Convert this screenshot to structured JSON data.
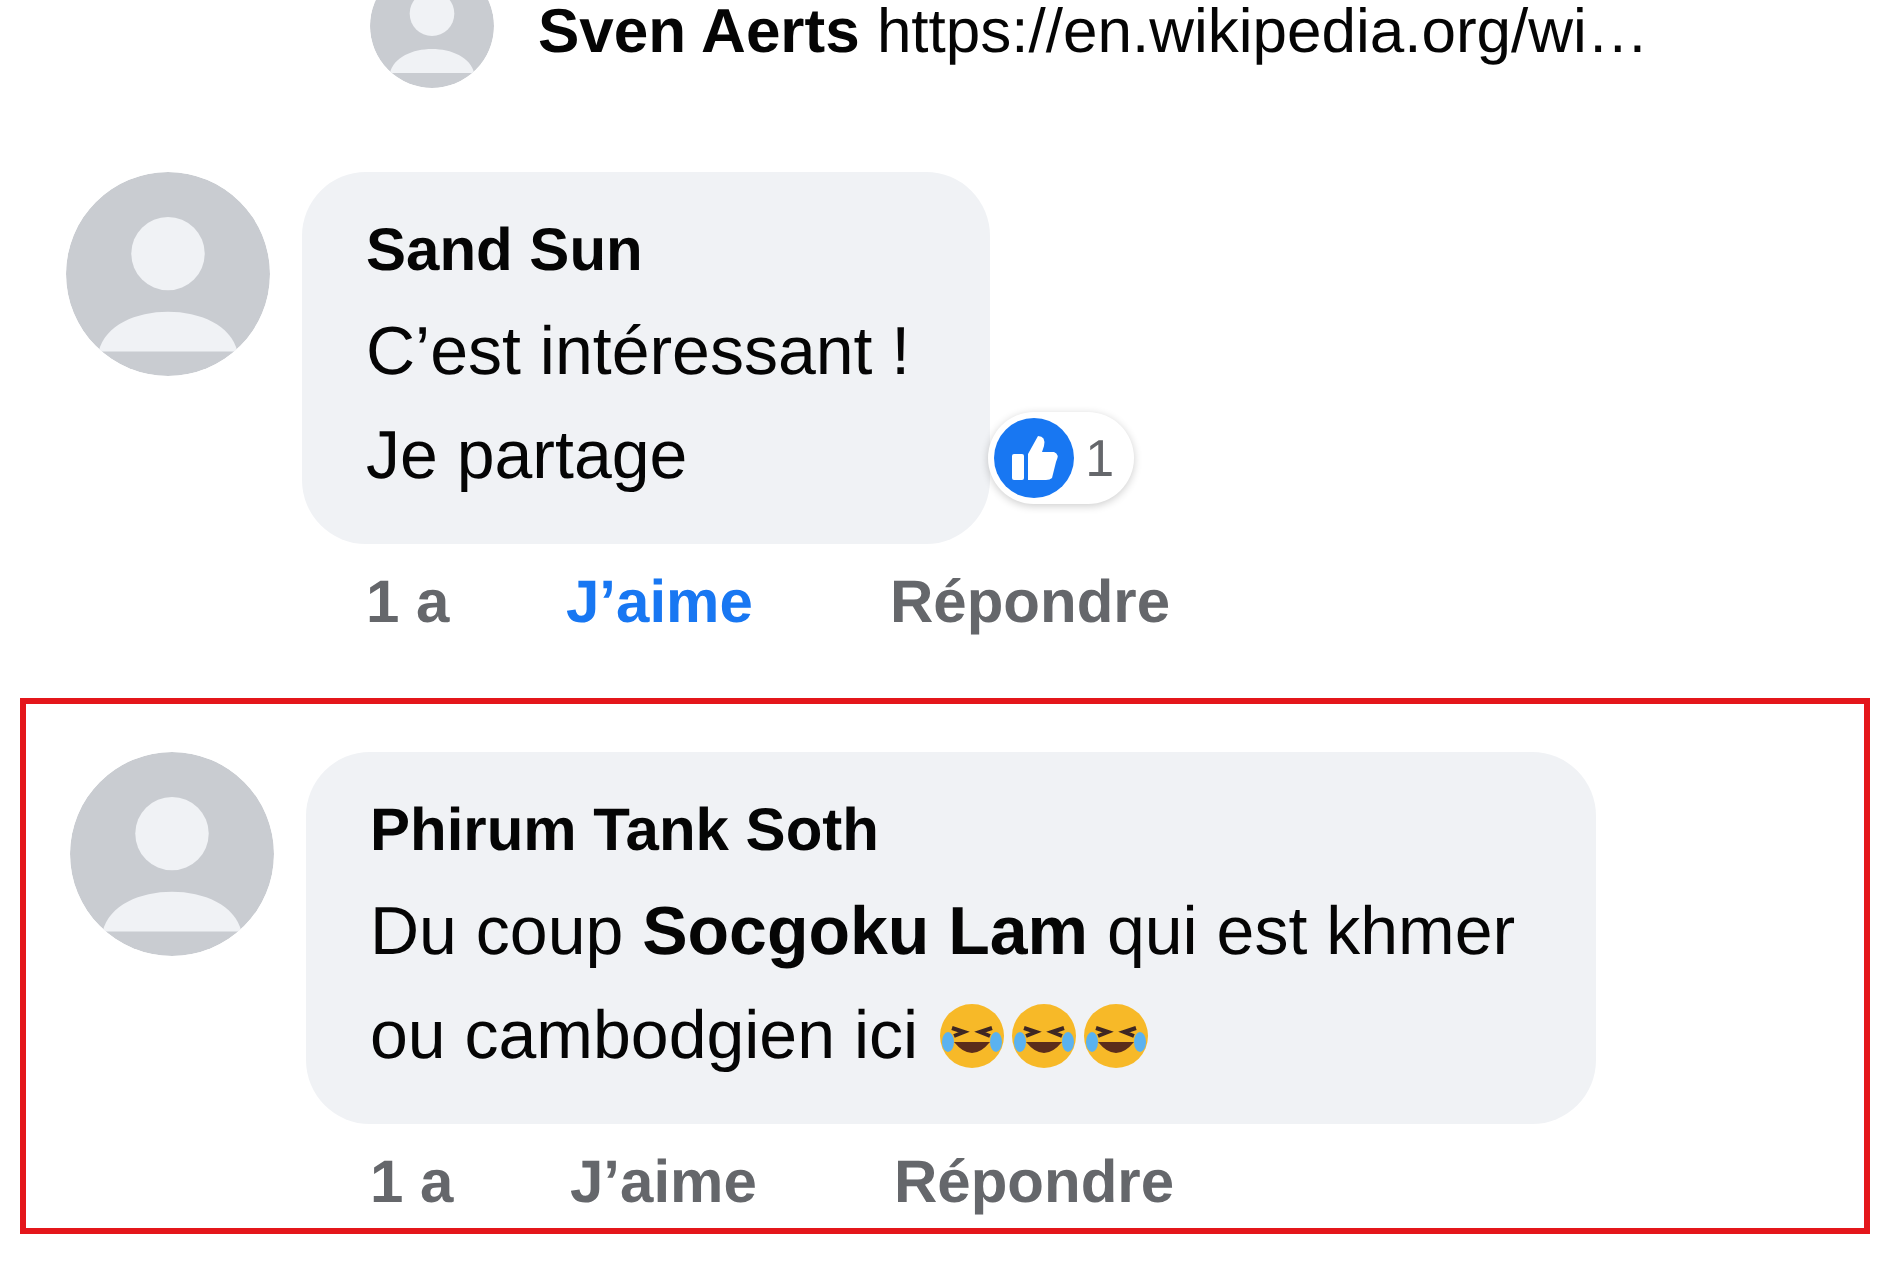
{
  "top_reply": {
    "author": "Sven Aerts",
    "text": "https://en.wikipedia.org/wi…"
  },
  "comments": [
    {
      "author": "Sand Sun",
      "lines": [
        "C’est intéressant !",
        "Je partage"
      ],
      "reactions": {
        "count": "1"
      },
      "time": "1 a",
      "like_label": "J’aime",
      "liked": true,
      "reply_label": "Répondre",
      "highlighted": false
    },
    {
      "author": "Phirum Tank Soth",
      "lines": [
        "Du coup **Socgoku Lam** qui est khmer",
        "ou cambodgien ici"
      ],
      "emojis": [
        {
          "kind": "rolling-laugh"
        },
        {
          "kind": "rolling-laugh"
        },
        {
          "kind": "rolling-laugh"
        }
      ],
      "time": "1 a",
      "like_label": "J’aime",
      "liked": false,
      "reply_label": "Répondre",
      "highlighted": true
    }
  ]
}
